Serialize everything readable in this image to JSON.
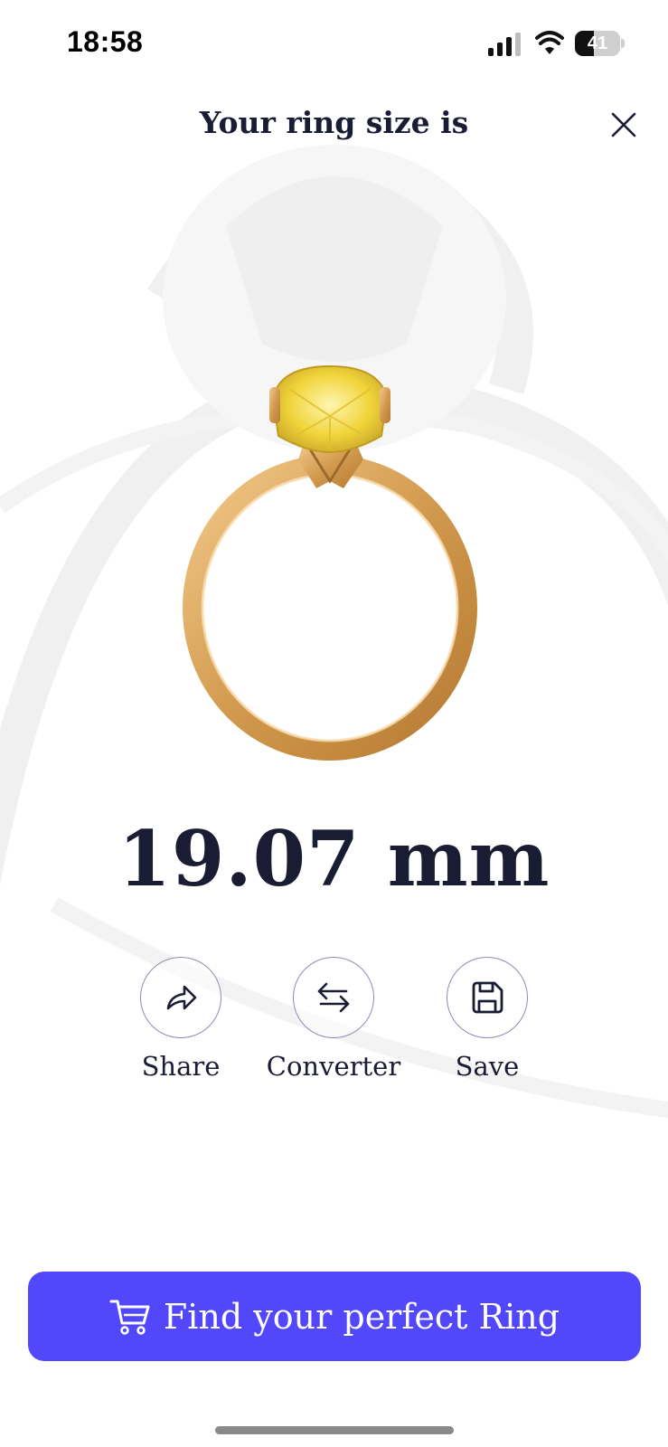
{
  "status_bar": {
    "time": "18:58",
    "battery_level": "41",
    "battery_fraction": 0.41,
    "icons": [
      "signal-icon",
      "wifi-icon",
      "battery-icon"
    ]
  },
  "header": {
    "title": "Your ring size is",
    "close_icon": "close-icon"
  },
  "result": {
    "ring_image": "gold-ring-yellow-diamond",
    "size_value": "19.07 mm"
  },
  "actions": [
    {
      "label": "Share",
      "icon": "share-icon"
    },
    {
      "label": "Converter",
      "icon": "swap-arrows-icon"
    },
    {
      "label": "Save",
      "icon": "floppy-disk-icon"
    }
  ],
  "cta": {
    "label": "Find your perfect Ring",
    "icon": "cart-icon"
  },
  "colors": {
    "accent": "#5247fb",
    "text": "#1a1c33",
    "ring_gold": "#d9a55a",
    "diamond": "#f2d63a"
  }
}
